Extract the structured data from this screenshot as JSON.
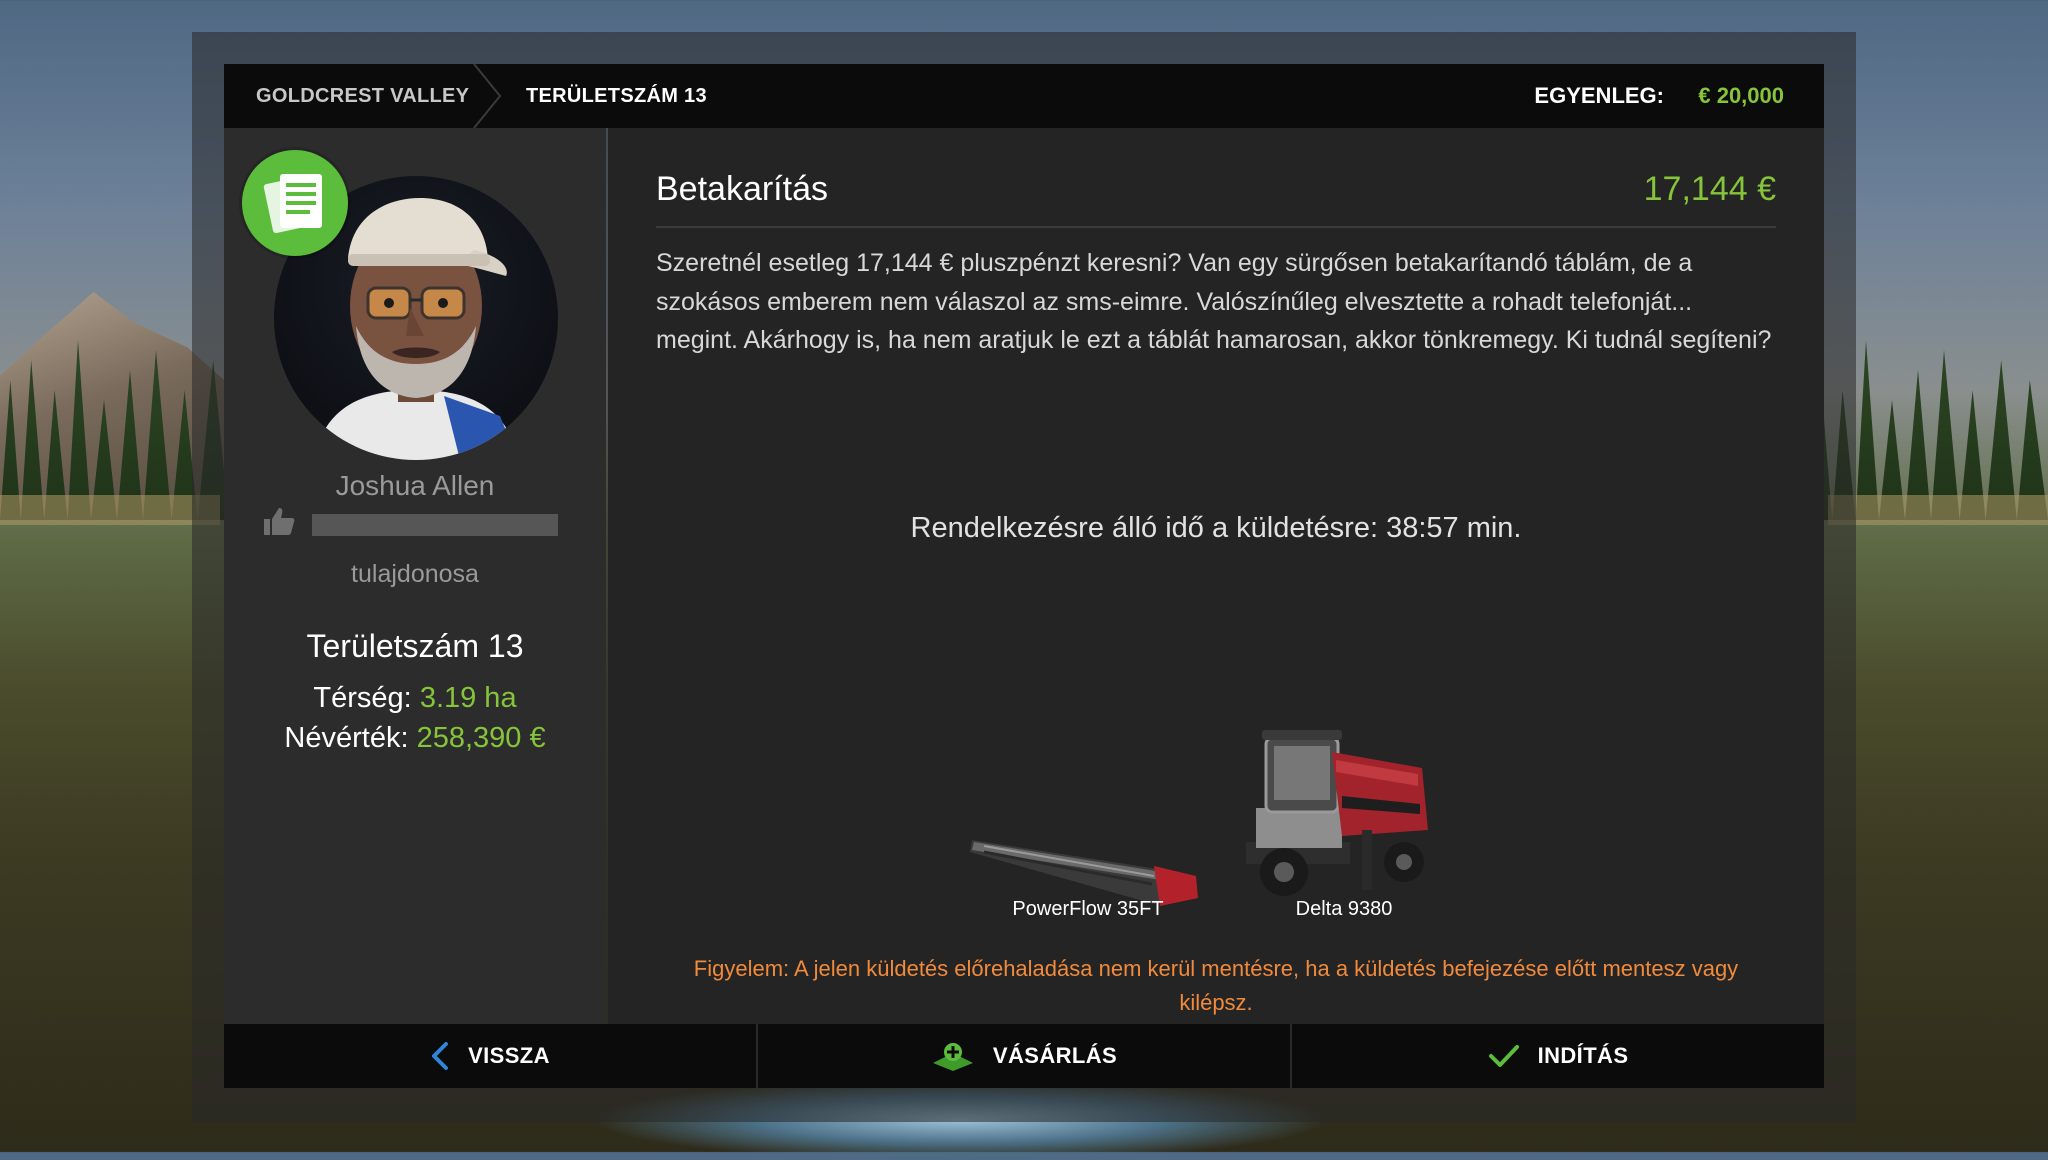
{
  "header": {
    "breadcrumb": [
      "GOLDCREST VALLEY",
      "TERÜLETSZÁM 13"
    ],
    "balance_label": "EGYENLEG:",
    "balance_value": "€ 20,000"
  },
  "npc": {
    "name": "Joshua Allen",
    "role": "tulajdonosa",
    "reputation_fraction": 0.0,
    "badge_icon": "contract-document-icon"
  },
  "field": {
    "title": "Területszám 13",
    "area_label": "Térség:",
    "area_value": "3.19 ha",
    "price_label": "Névérték:",
    "price_value": "258,390 €"
  },
  "mission": {
    "title": "Betakarítás",
    "reward": "17,144 €",
    "description": "Szeretnél esetleg 17,144 € pluszpénzt keresni? Van egy sürgősen betakarítandó táblám, de a szokásos emberem nem válaszol az sms-eimre. Valószínűleg elvesztette a rohadt telefonját... megint. Akárhogy is, ha nem aratjuk le ezt a táblát hamarosan, akkor tönkremegy. Ki tudnál segíteni?",
    "time_text": "Rendelkezésre álló idő a küldetésre: 38:57 min.",
    "vehicles": [
      {
        "name": "PowerFlow 35FT",
        "icon": "header-icon"
      },
      {
        "name": "Delta 9380",
        "icon": "combine-harvester-icon"
      }
    ],
    "warning": "Figyelem: A jelen küldetés előrehaladása nem kerül mentésre, ha a küldetés befejezése előtt mentesz vagy kilépsz."
  },
  "buttons": {
    "back": "VISSZA",
    "buy": "VÁSÁRLÁS",
    "start": "INDÍTÁS"
  },
  "colors": {
    "accent_green": "#86c43a",
    "warning_orange": "#f08a3c",
    "badge_green": "#5bbd3b"
  }
}
